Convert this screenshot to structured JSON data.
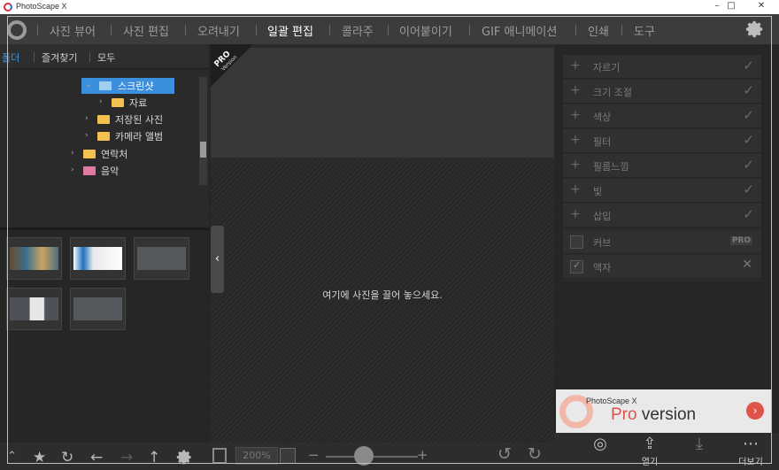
{
  "window": {
    "title": "PhotoScape X",
    "minimize": "–",
    "maximize": "□",
    "close": "✕"
  },
  "menu": {
    "items": [
      {
        "label": "사진 뷰어"
      },
      {
        "label": "사진 편집"
      },
      {
        "label": "오려내기"
      },
      {
        "label": "일괄 편집",
        "active": true
      },
      {
        "label": "콜라주"
      },
      {
        "label": "이어붙이기"
      },
      {
        "label": "GIF 애니메이션"
      },
      {
        "label": "인쇄"
      },
      {
        "label": "도구"
      }
    ]
  },
  "left_panel": {
    "tabs": [
      "폴더",
      "즐겨찾기",
      "모두"
    ],
    "tree": [
      {
        "label": "스크린샷",
        "selected": true
      },
      {
        "label": "자료"
      },
      {
        "label": "저장된 사진"
      },
      {
        "label": "카메라 앨범"
      },
      {
        "label": "연락처"
      },
      {
        "label": "음악"
      }
    ]
  },
  "center": {
    "pro_badge": "PRO",
    "pro_badge_sub": "Version",
    "drop_message": "여기에 사진을 끌어 놓으세요.",
    "zoom": "200%"
  },
  "right_panel": {
    "tools": [
      {
        "label": "자르기"
      },
      {
        "label": "크기 조절"
      },
      {
        "label": "색상"
      },
      {
        "label": "필터"
      },
      {
        "label": "필름느낌"
      },
      {
        "label": "빛"
      },
      {
        "label": "삽입"
      }
    ],
    "options": [
      {
        "label": "커브",
        "badge": "PRO"
      },
      {
        "label": "액자",
        "badge": "✕"
      }
    ]
  },
  "ad": {
    "brand": "PhotoScape X",
    "pro": "Pro",
    "version": " version"
  },
  "bottom_right": {
    "buttons": [
      {
        "icon": "target-icon",
        "label": ""
      },
      {
        "icon": "share-icon",
        "label": "열기"
      },
      {
        "icon": "download-icon",
        "label": ""
      },
      {
        "icon": "more-icon",
        "label": "더보기"
      }
    ]
  },
  "colors": {
    "accent": "#3b8fdd",
    "background": "#262626",
    "pro_red": "#e0534b"
  }
}
